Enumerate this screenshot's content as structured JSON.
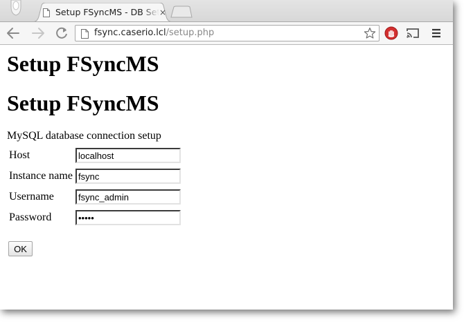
{
  "browser": {
    "tab_title": "Setup FSyncMS - DB Setup",
    "tab_close": "×",
    "url_host": "fsync.caserio.lcl",
    "url_path": "/setup.php"
  },
  "page": {
    "heading1": "Setup FSyncMS",
    "heading2": "Setup FSyncMS",
    "section_label": "MySQL database connection setup",
    "fields": [
      {
        "label": "Host",
        "value": "localhost"
      },
      {
        "label": "Instance name",
        "value": "fsync"
      },
      {
        "label": "Username",
        "value": "fsync_admin"
      },
      {
        "label": "Password",
        "value": "•••••"
      }
    ],
    "ok_button": "OK"
  },
  "icons": {
    "back": "back-arrow-icon",
    "forward": "forward-arrow-icon",
    "reload": "reload-icon",
    "page": "page-icon",
    "bookmark": "star-icon",
    "extension": "stop-hand-icon",
    "cast": "cast-icon",
    "menu": "hamburger-menu-icon"
  },
  "colors": {
    "extension_red": "#d32f2f"
  }
}
